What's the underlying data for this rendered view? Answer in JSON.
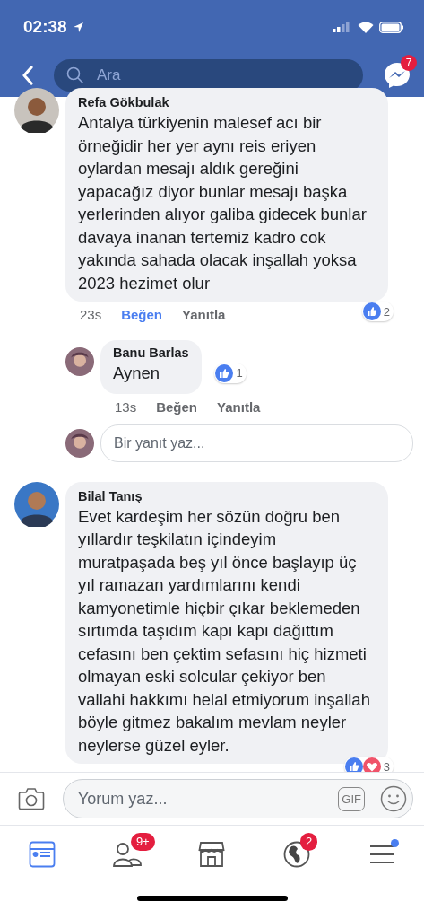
{
  "status_bar": {
    "time": "02:38"
  },
  "nav": {
    "search": {
      "placeholder": "Ara"
    },
    "messenger_badge": "7"
  },
  "comments": [
    {
      "author": "Refa Gökbulak",
      "text": "Antalya türkiyenin malesef acı bir örneğidir her yer aynı reis eriyen oylardan mesajı aldık gereğini yapacağız diyor bunlar mesajı başka yerlerinden alıyor galiba gidecek bunlar davaya inanan tertemiz kadro cok yakında sahada olacak inşallah yoksa 2023 hezimet olur",
      "time": "23s",
      "like_label": "Beğen",
      "liked": true,
      "reply_label": "Yanıtla",
      "reaction_count": "2",
      "reactions": [
        {
          "kind": "like"
        }
      ],
      "replies": [
        {
          "author": "Banu Barlas",
          "text": "Aynen",
          "time": "13s",
          "like_label": "Beğen",
          "liked": false,
          "reply_label": "Yanıtla",
          "reaction_count": "1",
          "reactions": [
            {
              "kind": "like"
            }
          ]
        }
      ],
      "reply_box": {
        "placeholder": "Bir yanıt yaz..."
      }
    },
    {
      "author": "Bilal Tanış",
      "text": "Evet kardeşim her sözün doğru ben yıllardır teşkilatın içindeyim muratpaşada  beş yıl önce başlayıp üç yıl ramazan yardımlarını kendi kamyonetimle hiçbir çıkar beklemeden sırtımda taşıdım kapı kapı dağıttım cefasını ben çektim sefasını hiç hizmeti olmayan eski solcular çekiyor ben vallahi hakkımı helal etmiyorum inşallah böyle gitmez bakalım mevlam neyler neylerse güzel eyler.",
      "reaction_count": "3",
      "reactions": [
        {
          "kind": "like"
        },
        {
          "kind": "love"
        }
      ]
    }
  ],
  "composer": {
    "placeholder": "Yorum yaz...",
    "gif_label": "GIF"
  },
  "tabs": [
    {
      "kind": "feed",
      "selected": true
    },
    {
      "kind": "friends",
      "selected": false,
      "badge": "9+"
    },
    {
      "kind": "market",
      "selected": false
    },
    {
      "kind": "globe",
      "selected": false,
      "badge": "2"
    },
    {
      "kind": "menu",
      "selected": false,
      "dot": true
    }
  ]
}
